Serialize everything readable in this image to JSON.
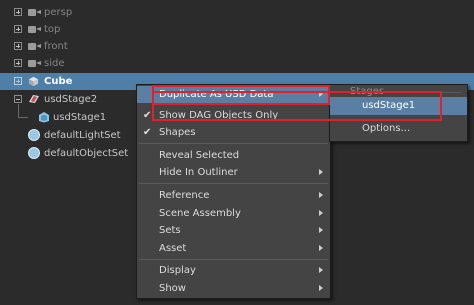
{
  "outliner": {
    "items": [
      {
        "label": "persp",
        "type": "camera",
        "dim": true
      },
      {
        "label": "top",
        "type": "camera",
        "dim": true
      },
      {
        "label": "front",
        "type": "camera",
        "dim": true
      },
      {
        "label": "side",
        "type": "camera",
        "dim": true
      },
      {
        "label": "Cube",
        "type": "mesh",
        "selected": true
      },
      {
        "label": "usdStage2",
        "type": "stage"
      },
      {
        "label": "usdStage1",
        "type": "stage-shape"
      },
      {
        "label": "defaultLightSet",
        "type": "set"
      },
      {
        "label": "defaultObjectSet",
        "type": "set"
      }
    ]
  },
  "context_menu": {
    "items": [
      {
        "label": "Duplicate As USD Data",
        "submenu": true,
        "highlighted": true
      },
      {
        "label": "Show DAG Objects Only",
        "checked": true
      },
      {
        "label": "Shapes",
        "checked": true
      },
      {
        "label": "Reveal Selected"
      },
      {
        "label": "Hide In Outliner",
        "submenu": true
      },
      {
        "label": "Reference",
        "submenu": true
      },
      {
        "label": "Scene Assembly",
        "submenu": true
      },
      {
        "label": "Sets",
        "submenu": true
      },
      {
        "label": "Asset",
        "submenu": true
      },
      {
        "label": "Display",
        "submenu": true
      },
      {
        "label": "Show",
        "submenu": true
      }
    ]
  },
  "submenu": {
    "header": "Stages",
    "items": [
      {
        "label": "usdStage1",
        "highlighted": true
      },
      {
        "label": "Options..."
      }
    ]
  },
  "colors": {
    "selection": "#4e7fa8",
    "highlight": "#5a7fa2",
    "annotation": "#e0202a",
    "background": "#2b2b2b",
    "menu_bg": "#444444"
  }
}
